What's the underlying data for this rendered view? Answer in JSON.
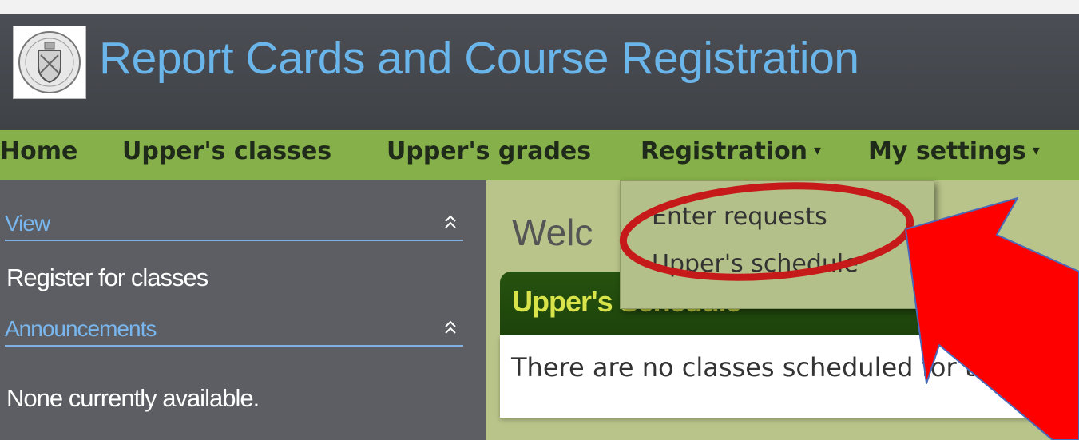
{
  "app": {
    "title": "Report Cards and Course Registration"
  },
  "nav": {
    "items": [
      {
        "label": "Home"
      },
      {
        "label": "Upper's classes"
      },
      {
        "label": "Upper's grades"
      },
      {
        "label": "Registration"
      },
      {
        "label": "My settings"
      }
    ],
    "caret": "▾"
  },
  "sidebar": {
    "view_heading": "View",
    "view_link": "Register for classes",
    "announcements_heading": "Announcements",
    "announcements_text": "None currently available.",
    "collapse_glyph": "⌃"
  },
  "main": {
    "welcome_text": "Welc",
    "panel_title": "Upper's Schedule",
    "panel_text": "There are no classes scheduled for the se"
  },
  "dropdown": {
    "items": [
      {
        "label": "Enter requests"
      },
      {
        "label": "Upper's schedule"
      }
    ]
  },
  "annotation": {
    "highlight_color": "#c61a1a",
    "arrow_color": "#ff0000"
  },
  "icons": {
    "logo": "school-crest-logo",
    "collapse": "double-chevron-up-icon",
    "caret": "caret-down-icon"
  }
}
